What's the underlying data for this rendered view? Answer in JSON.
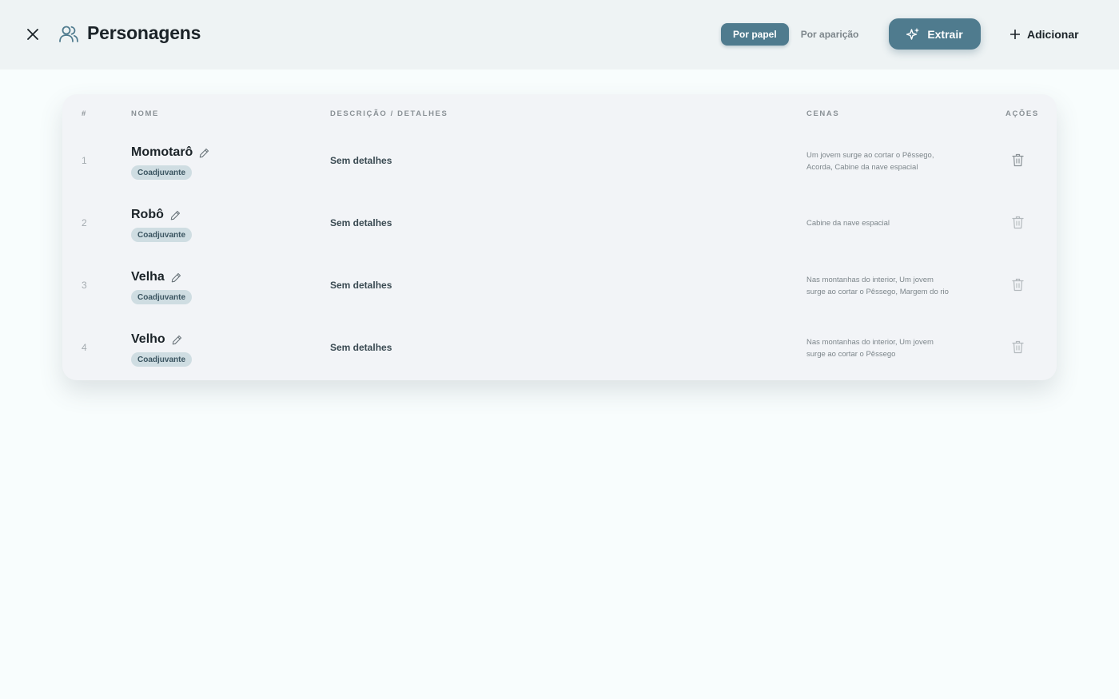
{
  "header": {
    "title": "Personagens",
    "view_modes": [
      "Por papel",
      "Por aparição"
    ],
    "active_view_mode": "Por papel",
    "extract_label": "Extrair",
    "add_label": "Adicionar"
  },
  "table": {
    "columns": [
      "#",
      "NOME",
      "DESCRIÇÃO / DETALHES",
      "CENAS",
      "AÇÕES"
    ],
    "rows": [
      {
        "num": "1",
        "name": "Momotarô",
        "role": "Coadjuvante",
        "description": "Sem detalhes",
        "scenes_lines": [
          "Um jovem surge ao cortar o Pêssego,",
          "Acorda, Cabine da nave espacial"
        ]
      },
      {
        "num": "2",
        "name": "Robô",
        "role": "Coadjuvante",
        "description": "Sem detalhes",
        "scenes_lines": [
          "Cabine da nave espacial"
        ]
      },
      {
        "num": "3",
        "name": "Velha",
        "role": "Coadjuvante",
        "description": "Sem detalhes",
        "scenes_lines": [
          "Nas montanhas do interior, Um jovem",
          "surge ao cortar o Pêssego, Margem do rio"
        ]
      },
      {
        "num": "4",
        "name": "Velho",
        "role": "Coadjuvante",
        "description": "Sem detalhes",
        "scenes_lines": [
          "Nas montanhas do interior, Um jovem",
          "surge ao cortar o Pêssego"
        ]
      }
    ]
  },
  "icons": {
    "close": "close-icon",
    "people": "people-icon",
    "sparkle": "sparkle-icon",
    "plus": "plus-icon",
    "edit": "pencil-icon",
    "trash": "trash-icon"
  },
  "colors": {
    "accent": "#4f7b8e",
    "header_bg": "#eef3f4",
    "page_bg": "#f8fdfd",
    "card_bg": "#f2f4f7",
    "badge_bg": "#cfdde2"
  }
}
